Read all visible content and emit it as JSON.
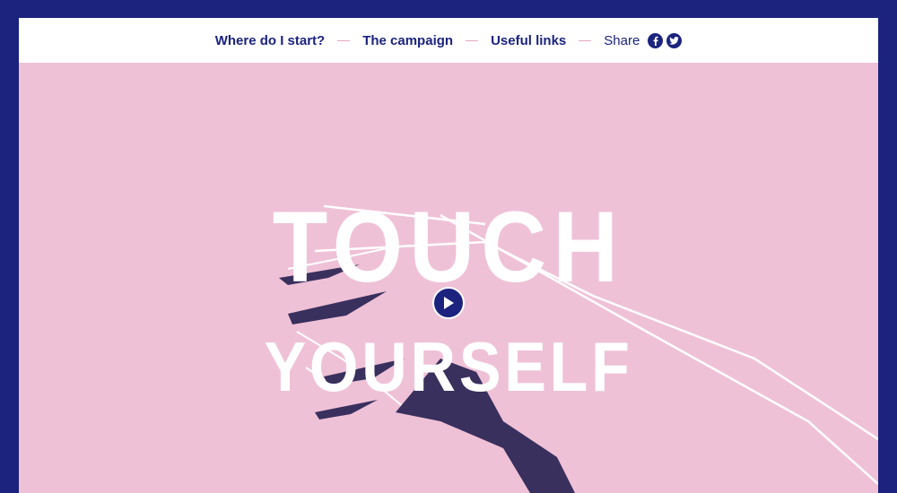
{
  "nav": {
    "links": [
      {
        "label": "Where do I start?"
      },
      {
        "label": "The campaign"
      },
      {
        "label": "Useful links"
      }
    ],
    "share_label": "Share",
    "social": [
      "facebook-icon",
      "twitter-icon"
    ]
  },
  "hero": {
    "title_line1": "TOUCH",
    "title_line2": "YOURSELF",
    "play_icon": "play-icon"
  },
  "colors": {
    "frame": "#1b237f",
    "background": "#efc1d7",
    "accent": "#1b237f",
    "text_light": "#ffffff"
  }
}
